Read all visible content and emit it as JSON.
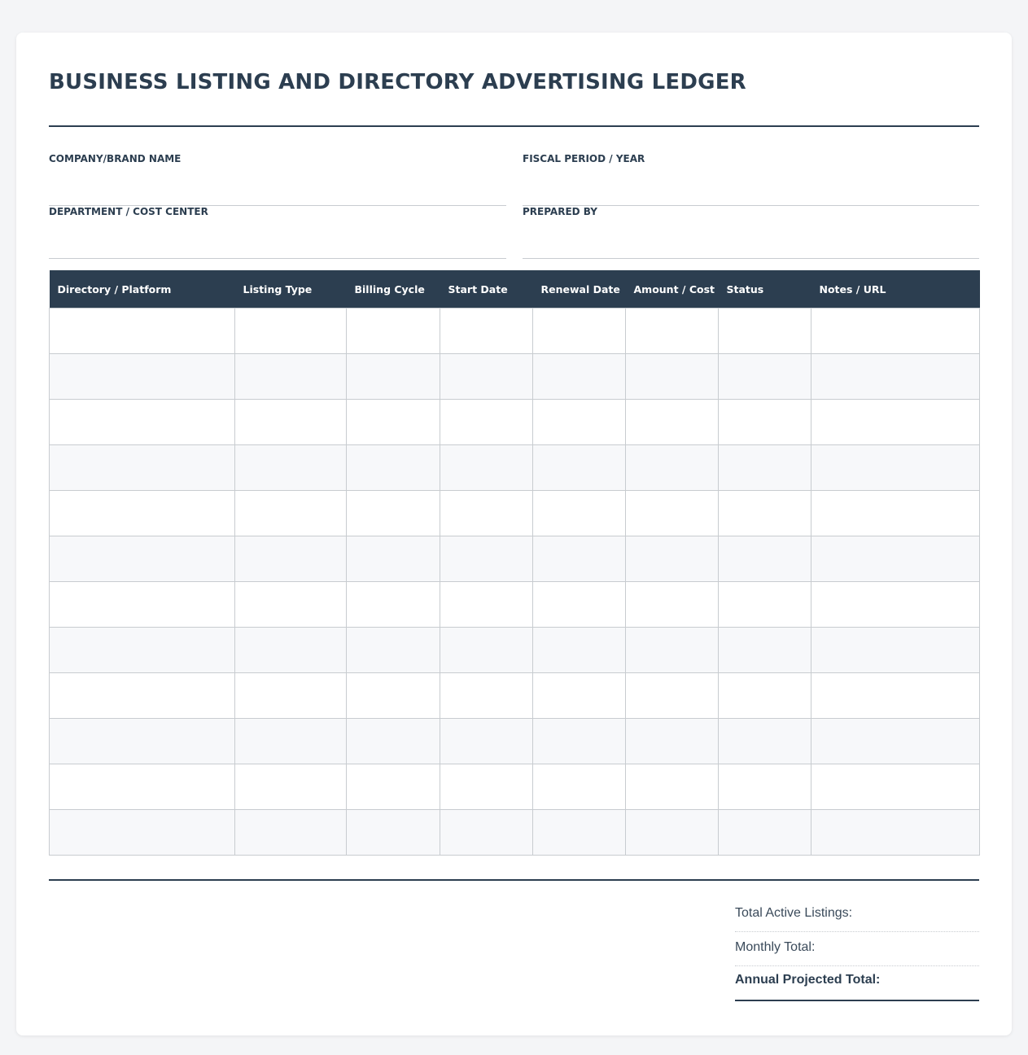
{
  "document": {
    "title": "BUSINESS LISTING AND DIRECTORY ADVERTISING LEDGER"
  },
  "fields": {
    "company": {
      "label": "COMPANY/BRAND NAME",
      "value": ""
    },
    "fiscal": {
      "label": "FISCAL PERIOD / YEAR",
      "value": ""
    },
    "department": {
      "label": "DEPARTMENT / COST CENTER",
      "value": ""
    },
    "prepared_by": {
      "label": "PREPARED BY",
      "value": ""
    }
  },
  "table": {
    "columns": [
      "Directory / Platform",
      "Listing Type",
      "Billing Cycle",
      "Start Date",
      "Renewal Date",
      "Amount / Cost",
      "Status",
      "Notes / URL"
    ],
    "rows": [
      [
        "",
        "",
        "",
        "",
        "",
        "",
        "",
        ""
      ],
      [
        "",
        "",
        "",
        "",
        "",
        "",
        "",
        ""
      ],
      [
        "",
        "",
        "",
        "",
        "",
        "",
        "",
        ""
      ],
      [
        "",
        "",
        "",
        "",
        "",
        "",
        "",
        ""
      ],
      [
        "",
        "",
        "",
        "",
        "",
        "",
        "",
        ""
      ],
      [
        "",
        "",
        "",
        "",
        "",
        "",
        "",
        ""
      ],
      [
        "",
        "",
        "",
        "",
        "",
        "",
        "",
        ""
      ],
      [
        "",
        "",
        "",
        "",
        "",
        "",
        "",
        ""
      ],
      [
        "",
        "",
        "",
        "",
        "",
        "",
        "",
        ""
      ],
      [
        "",
        "",
        "",
        "",
        "",
        "",
        "",
        ""
      ],
      [
        "",
        "",
        "",
        "",
        "",
        "",
        "",
        ""
      ],
      [
        "",
        "",
        "",
        "",
        "",
        "",
        "",
        ""
      ]
    ]
  },
  "summary": {
    "total_active_label": "Total Active Listings:",
    "monthly_total_label": "Monthly Total:",
    "annual_total_label": "Annual Projected Total:"
  },
  "colors": {
    "header_bg": "#2c3e50",
    "alt_row": "#f7f8fa",
    "page_bg": "#f4f5f7"
  }
}
